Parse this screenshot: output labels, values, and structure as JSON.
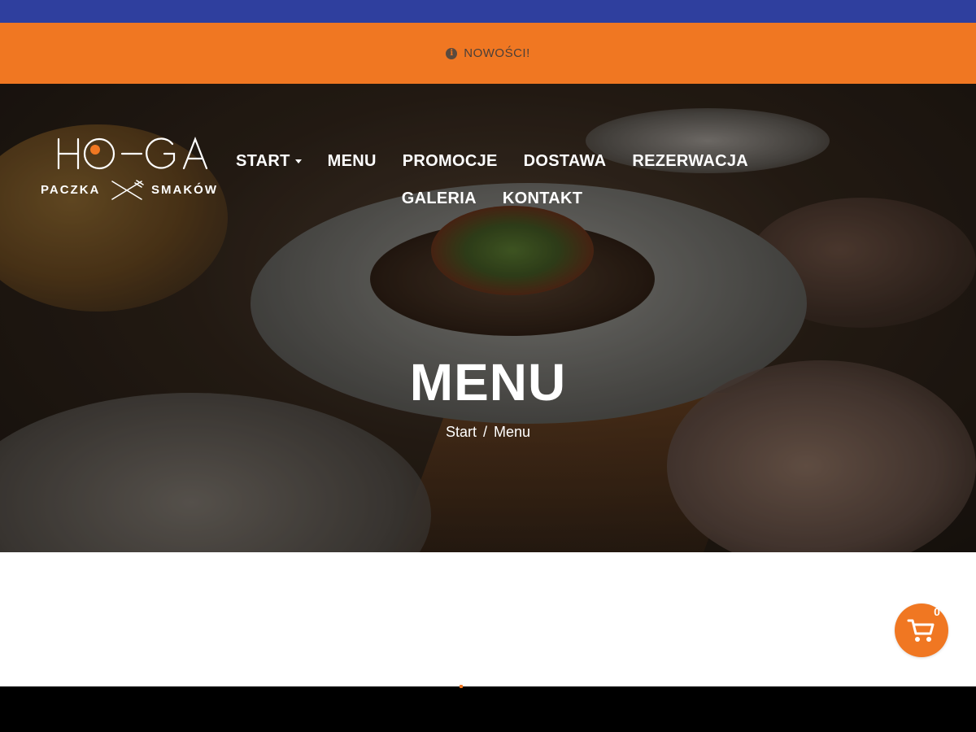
{
  "notice": {
    "icon": "info-icon",
    "text": "NOWOŚCI!"
  },
  "logo": {
    "mark_text": "HO-GA",
    "tagline_left": "PACZKA",
    "tagline_right": "SMAKÓW",
    "icon": "fork-knife-icon"
  },
  "nav": {
    "row1": [
      {
        "label": "START",
        "has_dropdown": true
      },
      {
        "label": "MENU"
      },
      {
        "label": "PROMOCJE"
      },
      {
        "label": "DOSTAWA"
      },
      {
        "label": "REZERWACJA"
      }
    ],
    "row2": [
      {
        "label": "GALERIA"
      },
      {
        "label": "KONTAKT"
      }
    ]
  },
  "hero": {
    "title": "MENU",
    "breadcrumb": {
      "home": "Start",
      "separator": "/",
      "current": "Menu"
    }
  },
  "cart": {
    "icon": "shopping-cart-icon",
    "count": "0"
  },
  "colors": {
    "top_strip": "#2f3f9e",
    "accent": "#f07722",
    "footer": "#000000"
  }
}
